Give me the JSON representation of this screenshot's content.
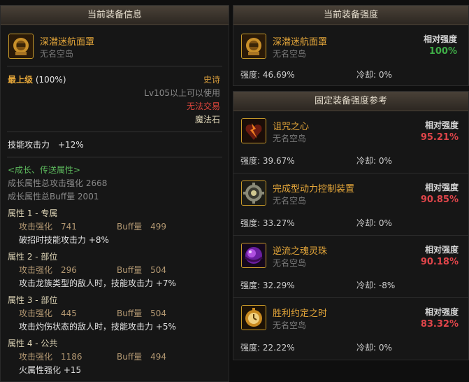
{
  "left": {
    "header": "当前装备信息",
    "item": {
      "name": "深潜迷航面罩",
      "sub": "无名空岛"
    },
    "grade": {
      "label": "最上级",
      "percent": "(100%)"
    },
    "rarity": "史诗",
    "level_req": "Lv105以上可以使用",
    "trade": "无法交易",
    "material": "魔法石",
    "skill_atk": "技能攻击力　+12%",
    "growth": {
      "title": "<成长、传送属性>",
      "total_atk": "成长属性总攻击强化 2668",
      "total_buff": "成长属性总Buff量 2001"
    },
    "attributes": [
      {
        "title": "属性 1 - 专属",
        "atk_label": "攻击强化",
        "atk": "741",
        "buff_label": "Buff量",
        "buff": "499",
        "effect": "破招时技能攻击力 +8%"
      },
      {
        "title": "属性 2 - 部位",
        "atk_label": "攻击强化",
        "atk": "296",
        "buff_label": "Buff量",
        "buff": "504",
        "effect": "攻击龙族类型的敌人时，技能攻击力 +7%"
      },
      {
        "title": "属性 3 - 部位",
        "atk_label": "攻击强化",
        "atk": "445",
        "buff_label": "Buff量",
        "buff": "504",
        "effect": "攻击灼伤状态的敌人时，技能攻击力 +5%"
      },
      {
        "title": "属性 4 - 公共",
        "atk_label": "攻击强化",
        "atk": "1186",
        "buff_label": "Buff量",
        "buff": "494",
        "effect": "火属性强化 +15"
      }
    ]
  },
  "current_strength": {
    "header": "当前装备强度",
    "item": {
      "name": "深潜迷航面罩",
      "sub": "无名空岛"
    },
    "rel_label": "相对强度",
    "rel_value": "100%",
    "strength": "强度: 46.69%",
    "cooldown": "冷却: 0%"
  },
  "fixed": {
    "header": "固定装备强度参考",
    "items": [
      {
        "name": "诅咒之心",
        "sub": "无名空岛",
        "rel_label": "相对强度",
        "rel_value": "95.21%",
        "strength": "强度: 39.67%",
        "cooldown": "冷却: 0%",
        "icon": "heart-icon"
      },
      {
        "name": "完成型动力控制装置",
        "sub": "无名空岛",
        "rel_label": "相对强度",
        "rel_value": "90.85%",
        "strength": "强度: 33.27%",
        "cooldown": "冷却: 0%",
        "icon": "gear-device-icon"
      },
      {
        "name": "逆流之魂灵珠",
        "sub": "无名空岛",
        "rel_label": "相对强度",
        "rel_value": "90.18%",
        "strength": "强度: 32.29%",
        "cooldown": "冷却: -8%",
        "icon": "orb-icon"
      },
      {
        "name": "胜利约定之时",
        "sub": "无名空岛",
        "rel_label": "相对强度",
        "rel_value": "83.32%",
        "strength": "强度: 22.22%",
        "cooldown": "冷却: 0%",
        "icon": "pocket-watch-icon"
      }
    ]
  },
  "colors": {
    "accent": "#e7a83a",
    "green": "#3fae47",
    "red": "#e0454a"
  }
}
